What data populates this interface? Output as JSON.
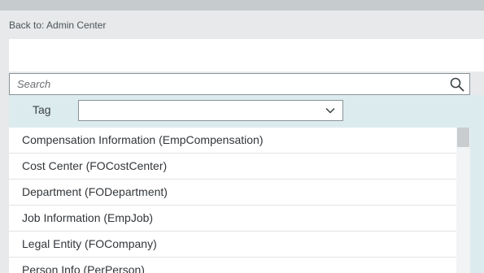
{
  "header": {
    "back_link": "Back to: Admin Center"
  },
  "search": {
    "placeholder": "Search",
    "value": ""
  },
  "filter": {
    "tag_label": "Tag",
    "tag_selected": ""
  },
  "list": {
    "items": [
      {
        "label": "Compensation Information (EmpCompensation)"
      },
      {
        "label": "Cost Center (FOCostCenter)"
      },
      {
        "label": "Department (FODepartment)"
      },
      {
        "label": "Job Information (EmpJob)"
      },
      {
        "label": "Legal Entity (FOCompany)"
      },
      {
        "label": "Person Info (PerPerson)"
      }
    ]
  },
  "icons": {
    "search": "search-icon",
    "dropdown": "chevron-down-icon"
  },
  "colors": {
    "tag_bar_bg": "#dcebee",
    "text": "#32363a"
  }
}
